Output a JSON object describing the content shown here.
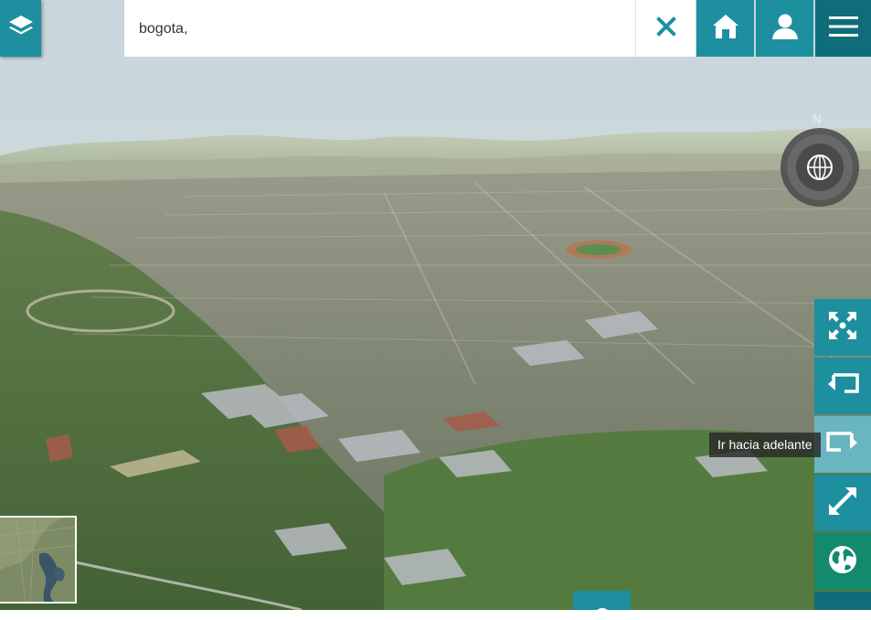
{
  "search": {
    "value": "bogota,",
    "placeholder": ""
  },
  "compass": {
    "north_label": "N"
  },
  "tooltip": {
    "text": "Ir hacia adelante"
  },
  "icons": {
    "layers": "layers-icon",
    "clear": "close-icon",
    "home": "home-icon",
    "user": "user-icon",
    "menu": "hamburger-menu-icon",
    "fullscreen": "fullscreen-icon",
    "back": "back-arrow-icon",
    "forward": "forward-arrow-icon",
    "expand": "expand-icon",
    "globe": "globe-icon",
    "locate": "location-pin-icon"
  },
  "colors": {
    "accent": "#1d8f9e",
    "accent_dark": "#0e6d78",
    "accent_light": "#69b5c0",
    "accent_green": "#138a6c"
  }
}
